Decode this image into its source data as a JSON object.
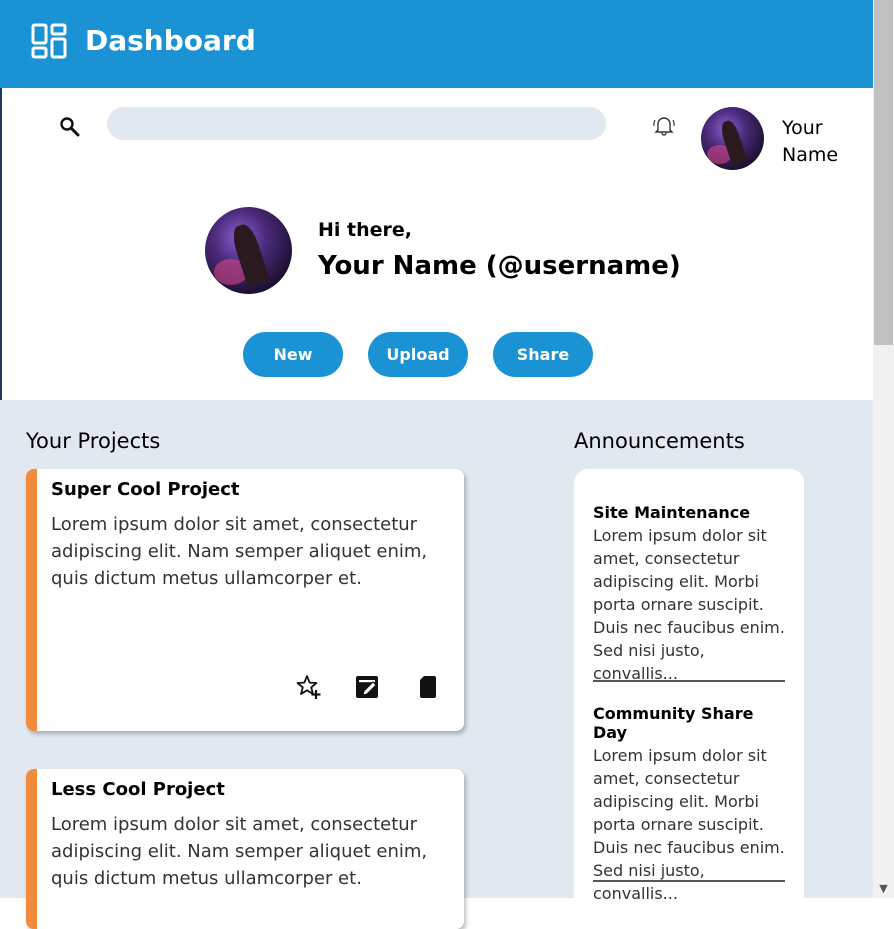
{
  "header": {
    "title": "Dashboard",
    "logo_icon": "dashboard-icon"
  },
  "search": {
    "value": "",
    "placeholder": ""
  },
  "user": {
    "name_short": "Your Name",
    "greeting": "Hi there,",
    "full_display": "Your Name (@username)"
  },
  "actions": {
    "new": "New",
    "upload": "Upload",
    "share": "Share"
  },
  "projects": {
    "section_title": "Your Projects",
    "items": [
      {
        "title": "Super Cool Project",
        "description": "Lorem ipsum dolor sit amet, consectetur adipiscing elit. Nam semper aliquet enim, quis dictum metus ullamcorper et."
      },
      {
        "title": "Less Cool Project",
        "description": "Lorem ipsum dolor sit amet, consectetur adipiscing elit. Nam semper aliquet enim, quis dictum metus ullamcorper et."
      }
    ]
  },
  "announcements": {
    "section_title": "Announcements",
    "items": [
      {
        "title": "Site Maintenance",
        "body": "Lorem ipsum dolor sit amet, consectetur adipiscing elit. Morbi porta ornare suscipit. Duis nec faucibus enim. Sed nisi justo, convallis..."
      },
      {
        "title": "Community Share Day",
        "body": "Lorem ipsum dolor sit amet, consectetur adipiscing elit. Morbi porta ornare suscipit. Duis nec faucibus enim. Sed nisi justo, convallis..."
      }
    ]
  },
  "colors": {
    "brand": "#1b92d3",
    "accent": "#f28b3c",
    "background": "#e2e8f0"
  }
}
